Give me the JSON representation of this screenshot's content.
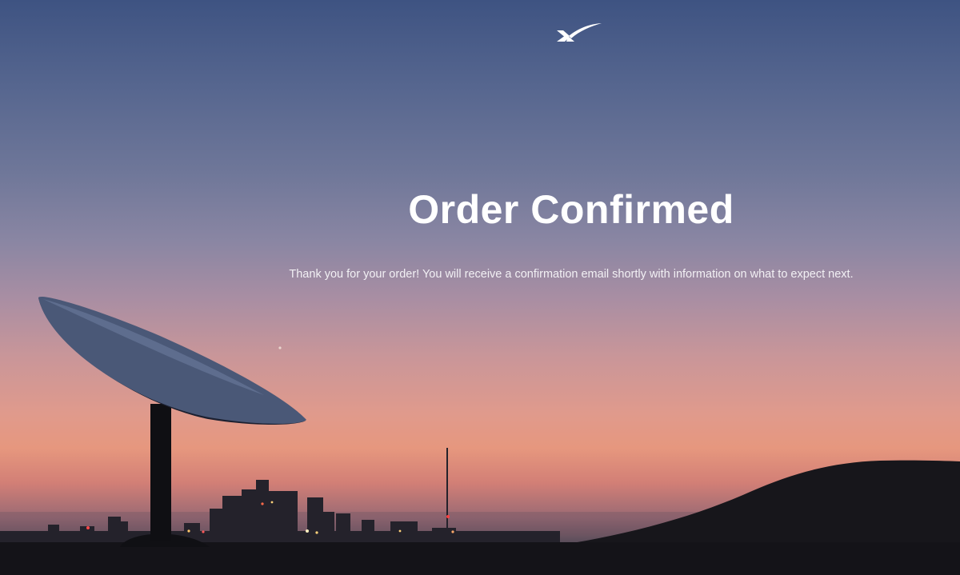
{
  "brand": {
    "logo_icon": "spacex-x-logo-icon"
  },
  "confirmation": {
    "title": "Order Confirmed",
    "message": "Thank you for your order! You will receive a confirmation email shortly with information on what to expect next."
  },
  "background": {
    "scene": "starlink-dish-silhouette-at-dusk-over-city-skyline",
    "colors": {
      "sky_top": "#3e5382",
      "sky_mid": "#a98ea3",
      "horizon_glow": "#e6977e",
      "ground": "#141318"
    }
  }
}
